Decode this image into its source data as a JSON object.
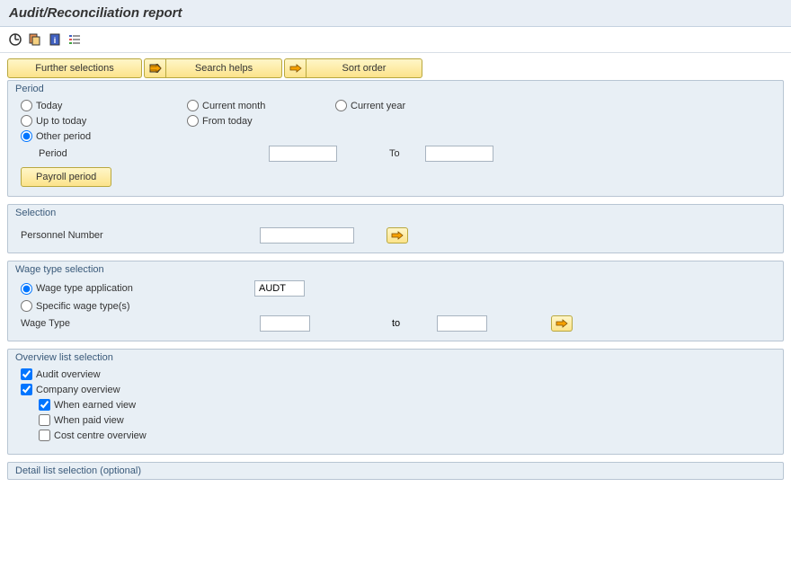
{
  "title": "Audit/Reconciliation report",
  "toolbar_buttons": {
    "further_selections": "Further selections",
    "search_helps": "Search helps",
    "sort_order": "Sort order"
  },
  "period": {
    "group_label": "Period",
    "today": "Today",
    "current_month": "Current month",
    "current_year": "Current year",
    "up_to_today": "Up to today",
    "from_today": "From today",
    "other_period": "Other period",
    "period_label": "Period",
    "period_value": "",
    "to_label": "To",
    "to_value": "",
    "payroll_period": "Payroll period"
  },
  "selection": {
    "group_label": "Selection",
    "personnel_number_label": "Personnel Number",
    "personnel_number_value": ""
  },
  "wage_type_selection": {
    "group_label": "Wage type selection",
    "wage_type_application": "Wage type application",
    "app_value": "AUDT",
    "specific_wage_types": "Specific wage type(s)",
    "wage_type_label": "Wage Type",
    "wage_type_from": "",
    "to_label": "to",
    "wage_type_to": ""
  },
  "overview": {
    "group_label": "Overview list selection",
    "audit_overview": "Audit overview",
    "company_overview": "Company overview",
    "when_earned": "When earned view",
    "when_paid": "When paid view",
    "cost_centre": "Cost centre overview"
  },
  "detail": {
    "group_label": "Detail list selection (optional)"
  }
}
